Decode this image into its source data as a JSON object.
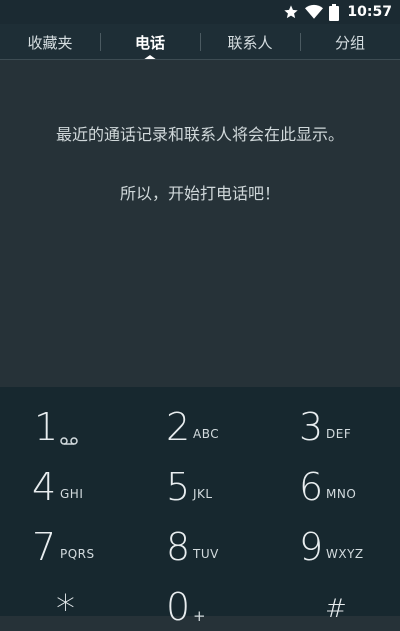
{
  "status_bar": {
    "time": "10:57",
    "icons": [
      "star-icon",
      "wifi-icon",
      "battery-icon"
    ]
  },
  "tabs": [
    {
      "label": "收藏夹",
      "active": false
    },
    {
      "label": "电话",
      "active": true
    },
    {
      "label": "联系人",
      "active": false
    },
    {
      "label": "分组",
      "active": false
    }
  ],
  "empty_state": {
    "line1": "最近的通话记录和联系人将会在此显示。",
    "line2": "所以，开始打电话吧！"
  },
  "dialpad": {
    "keys": [
      {
        "digit": "1",
        "letters": "",
        "icon": "voicemail-icon"
      },
      {
        "digit": "2",
        "letters": "ABC"
      },
      {
        "digit": "3",
        "letters": "DEF"
      },
      {
        "digit": "4",
        "letters": "GHI"
      },
      {
        "digit": "5",
        "letters": "JKL"
      },
      {
        "digit": "6",
        "letters": "MNO"
      },
      {
        "digit": "7",
        "letters": "PQRS"
      },
      {
        "digit": "8",
        "letters": "TUV"
      },
      {
        "digit": "9",
        "letters": "WXYZ"
      },
      {
        "digit": "*",
        "letters": ""
      },
      {
        "digit": "0",
        "letters": "+"
      },
      {
        "digit": "#",
        "letters": ""
      }
    ]
  },
  "colors": {
    "status_bar": "#1b2a32",
    "tab_bar": "#1e2e36",
    "content": "#263238",
    "dialpad": "#17282f"
  }
}
